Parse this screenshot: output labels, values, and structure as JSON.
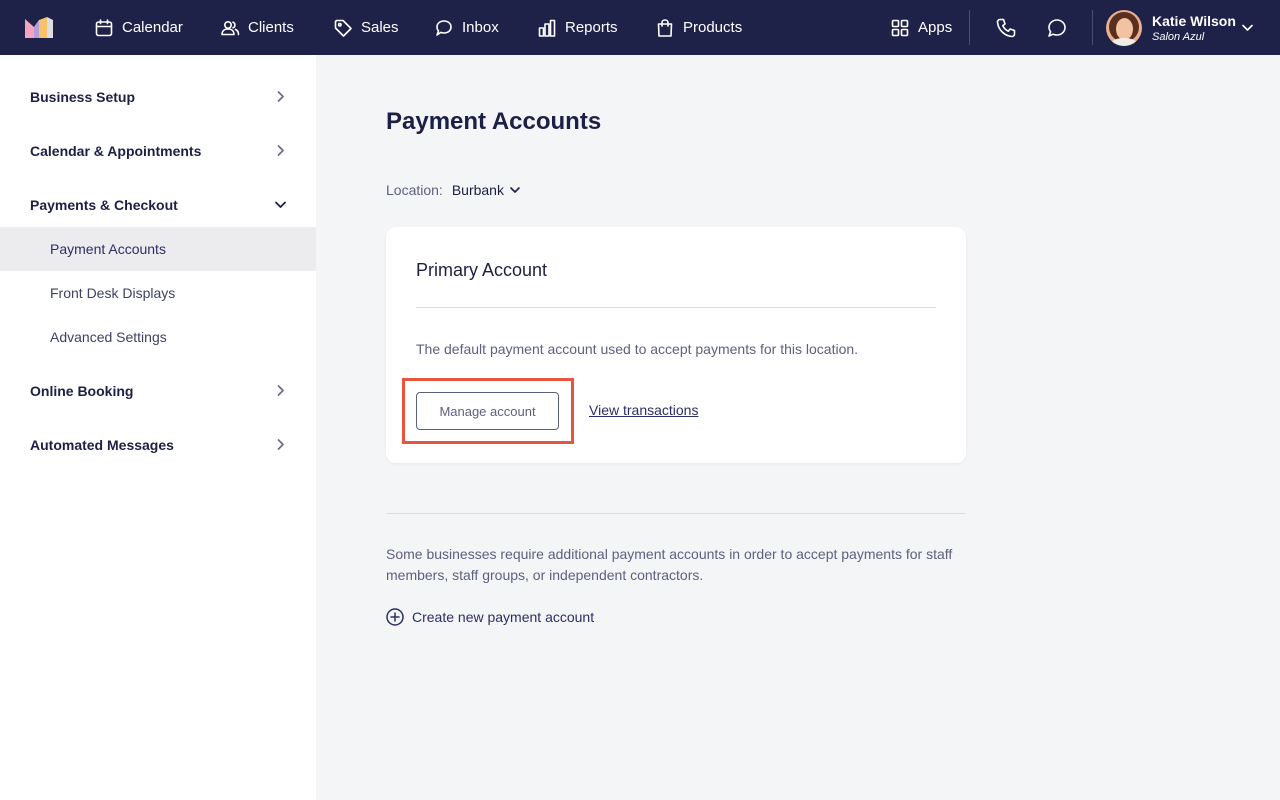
{
  "nav": {
    "items": [
      {
        "label": "Calendar",
        "icon": "calendar-icon"
      },
      {
        "label": "Clients",
        "icon": "clients-icon"
      },
      {
        "label": "Sales",
        "icon": "tag-icon"
      },
      {
        "label": "Inbox",
        "icon": "chat-bubble-icon"
      },
      {
        "label": "Reports",
        "icon": "bar-chart-icon"
      },
      {
        "label": "Products",
        "icon": "shopping-bag-icon"
      }
    ],
    "apps_label": "Apps",
    "user_name": "Katie Wilson",
    "user_org": "Salon Azul"
  },
  "sidebar": {
    "sections": [
      {
        "label": "Business Setup",
        "expanded": false
      },
      {
        "label": "Calendar & Appointments",
        "expanded": false
      },
      {
        "label": "Payments & Checkout",
        "expanded": true
      },
      {
        "label": "Online Booking",
        "expanded": false
      },
      {
        "label": "Automated Messages",
        "expanded": false
      }
    ],
    "sub_items": [
      {
        "label": "Payment Accounts",
        "active": true
      },
      {
        "label": "Front Desk Displays",
        "active": false
      },
      {
        "label": "Advanced Settings",
        "active": false
      }
    ]
  },
  "main": {
    "title": "Payment Accounts",
    "location_label": "Location:",
    "location_value": "Burbank",
    "card": {
      "title": "Primary Account",
      "description": "The default payment account used to accept payments for this location.",
      "manage_label": "Manage account",
      "view_label": "View transactions"
    },
    "info_text": "Some businesses require additional payment accounts in order to accept payments for staff members, staff groups, or independent contractors.",
    "create_label": "Create new payment account"
  },
  "colors": {
    "topbar": "#1e2148",
    "text_primary": "#1c2045",
    "text_secondary": "#5d6180",
    "highlight": "#e8553f",
    "active_item_bg": "#ececef"
  }
}
